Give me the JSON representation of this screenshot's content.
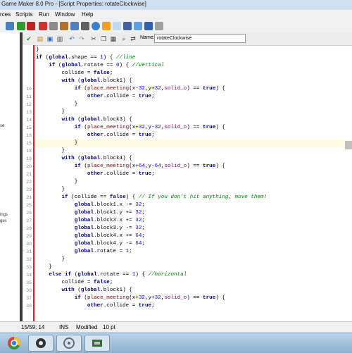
{
  "window": {
    "title": "Game Maker 8.0 Pro - [Script Properties: rotateClockwise]"
  },
  "menu": [
    "rces",
    "Scripts",
    "Run",
    "Window",
    "Help"
  ],
  "left_panel": {
    "items": [
      "se",
      "ings",
      "ges"
    ]
  },
  "script": {
    "name_label": "Name:",
    "name_value": "rotateClockwise"
  },
  "editor": {
    "highlight_line": 15,
    "lines": [
      {
        "n": "",
        "t": "}"
      },
      {
        "n": "",
        "t": "if (global.shape == 1) { //line"
      },
      {
        "n": "",
        "t": "    if (global.rotate == 0) { //vertical"
      },
      {
        "n": "",
        "t": "        collide = false;"
      },
      {
        "n": "",
        "t": "        with (global.block1) {"
      },
      {
        "n": "10",
        "t": "            if (place_meeting(x-32,y+32,solid_o) == true) {"
      },
      {
        "n": "11",
        "t": "                other.collide = true;"
      },
      {
        "n": "12",
        "t": "            }"
      },
      {
        "n": "13",
        "t": "        }"
      },
      {
        "n": "14",
        "t": "        with (global.block3) {"
      },
      {
        "n": "15",
        "t": "            if (place_meeting(x+32,y-32,solid_o) == true) {"
      },
      {
        "n": "16",
        "t": "                other.collide = true;"
      },
      {
        "n": "15",
        "t": "            }"
      },
      {
        "n": "18",
        "t": "        }"
      },
      {
        "n": "19",
        "t": "        with (global.block4) {"
      },
      {
        "n": "20",
        "t": "            if (place_meeting(x+64,y-64,solid_o) == true) {"
      },
      {
        "n": "21",
        "t": "                other.collide = true;"
      },
      {
        "n": "22",
        "t": "            }"
      },
      {
        "n": "23",
        "t": "        }"
      },
      {
        "n": "21",
        "t": "        if (collide == false) { // If you don't hit anything, move them!"
      },
      {
        "n": "25",
        "t": "            global.block1.x -= 32;"
      },
      {
        "n": "26",
        "t": "            global.block1.y += 32;"
      },
      {
        "n": "27",
        "t": "            global.block3.x += 32;"
      },
      {
        "n": "28",
        "t": "            global.block3.y -= 32;"
      },
      {
        "n": "29",
        "t": "            global.block4.x += 64;"
      },
      {
        "n": "30",
        "t": "            global.block4.y -= 64;"
      },
      {
        "n": "31",
        "t": "            global.rotate = 1;"
      },
      {
        "n": "32",
        "t": "        }"
      },
      {
        "n": "33",
        "t": "    }"
      },
      {
        "n": "34",
        "t": "    else if (global.rotate == 1) { //horizontal"
      },
      {
        "n": "35",
        "t": "        collide = false;"
      },
      {
        "n": "36",
        "t": "        with (global.block1) {"
      },
      {
        "n": "37",
        "t": "            if (place_meeting(x+32,y+32,solid_o) == true) {"
      },
      {
        "n": "38",
        "t": "                other.collide = true;"
      }
    ]
  },
  "status": {
    "position": "15/59: 14",
    "mode": "INS",
    "modified": "Modified",
    "font_size": "10 pt"
  },
  "colors": {
    "gutter_marker": "#dd2222",
    "keyword": "#000080",
    "comment": "#008000",
    "number": "#0000ff"
  }
}
